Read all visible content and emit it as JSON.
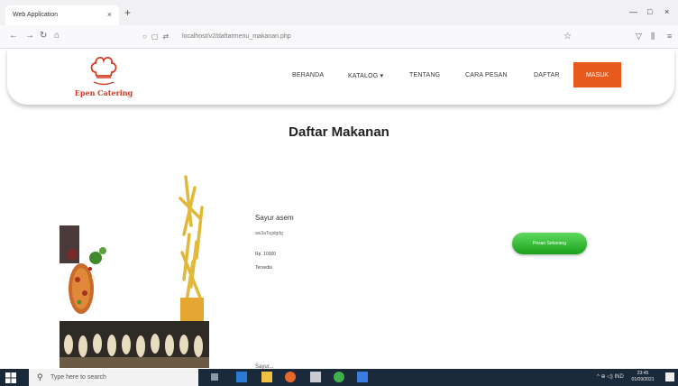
{
  "browser": {
    "tab_title": "Web Application",
    "tab_close": "×",
    "new_tab": "+",
    "url": "localhost/v2/daftarmenu_makanan.php",
    "minimize": "—",
    "maximize": "□",
    "close": "×"
  },
  "site": {
    "logo_text": "Epen Catering",
    "nav": [
      {
        "label": "BERANDA"
      },
      {
        "label": "KATALOG ▾"
      },
      {
        "label": "TENTANG"
      },
      {
        "label": "CARA PESAN"
      },
      {
        "label": "DAFTAR"
      }
    ],
    "login_label": "MASUK",
    "accent": "#e8591c",
    "logo_color": "#d33b22"
  },
  "content": {
    "title": "Daftar Makanan",
    "item": {
      "name": "Sayur asem",
      "desc": "aw3aTsgdgdg",
      "price": "Rp. 10000",
      "status": "Tersedia",
      "order_label": "Pesan Sekarang",
      "order_color": "#1aa11a"
    },
    "next_item_name": "Sayur..."
  },
  "taskbar": {
    "search_placeholder": "Type here to search",
    "tray_text": "^ ⊕ ◁) IND",
    "time": "23:45",
    "date": "01/09/2021"
  }
}
